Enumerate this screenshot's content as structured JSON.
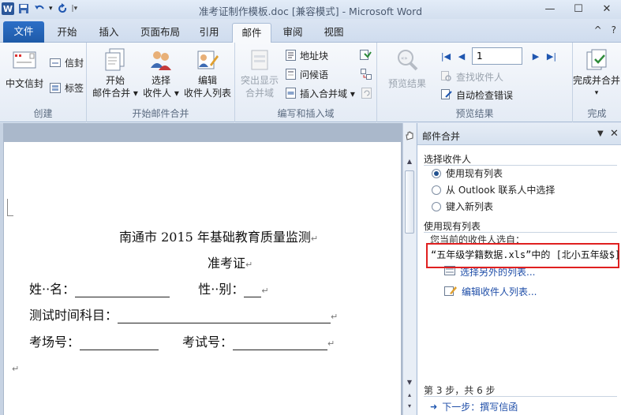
{
  "app": {
    "title": "准考证制作模板.doc [兼容模式] - Microsoft Word"
  },
  "qat": {
    "undo_arrow": "▾",
    "qat_more": "|▾"
  },
  "window": {
    "minimize": "—",
    "maximize": "☐",
    "close": "✕"
  },
  "tabs": [
    {
      "label": "文件"
    },
    {
      "label": "开始"
    },
    {
      "label": "插入"
    },
    {
      "label": "页面布局"
    },
    {
      "label": "引用"
    },
    {
      "label": "邮件"
    },
    {
      "label": "审阅"
    },
    {
      "label": "视图"
    }
  ],
  "tab_right": {
    "collapse": "^",
    "help": "?"
  },
  "ribbon": {
    "create": {
      "label": "创建",
      "chinese_envelope": "中文信封",
      "envelopes": "信封",
      "labels": "标签"
    },
    "start_merge": {
      "label": "开始邮件合并",
      "start_l1": "开始",
      "start_l2": "邮件合并 ▾",
      "select_l1": "选择",
      "select_l2": "收件人 ▾",
      "edit_l1": "编辑",
      "edit_l2": "收件人列表"
    },
    "write_insert": {
      "label": "编写和插入域",
      "highlight_l1": "突出显示",
      "highlight_l2": "合并域",
      "address_block": "地址块",
      "greeting_line": "问候语",
      "insert_merge_field": "插入合并域 ▾"
    },
    "preview": {
      "label": "预览结果",
      "preview_results": "预览结果",
      "record_value": "1",
      "find_recipient": "查找收件人",
      "auto_check": "自动检查错误"
    },
    "finish": {
      "label": "完成",
      "finish_merge": "完成并合并",
      "finish_arrow": "▾"
    }
  },
  "document": {
    "title": "南通市 2015 年基础教育质量监测",
    "subtitle": "准考证",
    "row1_name": "姓··名：",
    "row1_gender": "性··别：",
    "row2_label": "测试时间科目：",
    "row3_room": "考场号：",
    "row3_exam": "考试号：",
    "para_mark": "↵"
  },
  "pane": {
    "title": "邮件合并",
    "section_select": "选择收件人",
    "option_existing": "使用现有列表",
    "option_outlook": "从 Outlook 联系人中选择",
    "option_new": "键入新列表",
    "section_existing": "使用现有列表",
    "current_from": "您当前的收件人选自：",
    "source": "“五年级学籍数据.xls”中的 [北小五年级$]",
    "select_other": "选择另外的列表...",
    "edit_list": "编辑收件人列表...",
    "step": "第 3 步，共 6 步",
    "next_step": "下一步：撰写信函"
  }
}
